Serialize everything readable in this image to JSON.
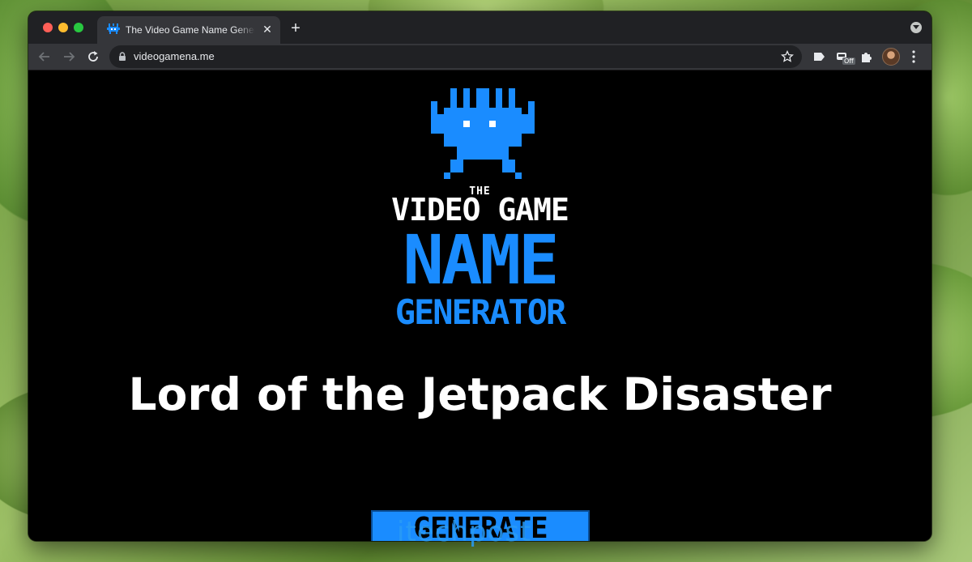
{
  "browser": {
    "tab": {
      "title": "The Video Game Name Generator"
    },
    "address_bar": {
      "url": "videogamena.me"
    },
    "extension_badge": "Off",
    "colors": {
      "tab_bar": "#202124",
      "toolbar": "#35363a",
      "accent_blue": "#1a8cff"
    }
  },
  "page": {
    "logo": {
      "line_the": "THE",
      "line_video_game": "VIDEO GAME",
      "line_name": "NAME",
      "line_generator": "GENERATOR"
    },
    "generated_name": "Lord of the Jetpack Disaster",
    "generate_button": "GENERATE"
  },
  "watermark": "itechpost"
}
